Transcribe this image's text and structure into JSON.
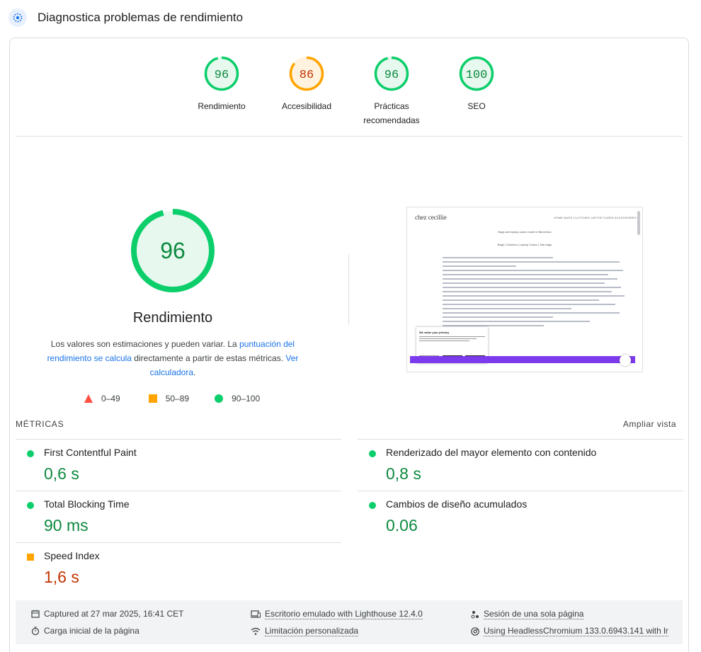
{
  "header": {
    "title": "Diagnostica problemas de rendimiento"
  },
  "scores": [
    {
      "value": "96",
      "label": "Rendimiento",
      "status": "pass"
    },
    {
      "value": "86",
      "label": "Accesibilidad",
      "status": "average"
    },
    {
      "value": "96",
      "label": "Prácticas recomendadas",
      "status": "pass"
    },
    {
      "value": "100",
      "label": "SEO",
      "status": "pass"
    }
  ],
  "main": {
    "score": "96",
    "title": "Rendimiento",
    "desc_pre": "Los valores son estimaciones y pueden variar. La ",
    "desc_link1": "puntuación del rendimiento se calcula",
    "desc_mid": " directamente a partir de estas métricas. ",
    "desc_link2": "Ver calculadora",
    "desc_end": "."
  },
  "legend": {
    "fail": "0–49",
    "average": "50–89",
    "pass": "90–100"
  },
  "screenshot": {
    "brand": "chez cecillie",
    "nav": "HOME   BAGS   CLUTCHES   LAPTOP CASES   ACCESSORIES",
    "tagline": "Bags and laptop cases made in Barcelona",
    "tabs": "Bags  |  Clutches  |  Laptop Cases  |  Tote bags",
    "cookie_title": "We value your privacy"
  },
  "metrics": {
    "heading": "MÉTRICAS",
    "expand": "Ampliar vista",
    "fcp": {
      "name": "First Contentful Paint",
      "value": "0,6 s"
    },
    "lcp": {
      "name": "Renderizado del mayor elemento con contenido",
      "value": "0,8 s"
    },
    "tbt": {
      "name": "Total Blocking Time",
      "value": "90 ms"
    },
    "cls": {
      "name": "Cambios de diseño acumulados",
      "value": "0.06"
    },
    "si": {
      "name": "Speed Index",
      "value": "1,6 s"
    }
  },
  "footer": {
    "captured": "Captured at 27 mar 2025, 16:41 CET",
    "load": "Carga inicial de la página",
    "emulated": "Escritorio emulado with Lighthouse 12.4.0",
    "throttling": "Limitación personalizada",
    "session": "Sesión de una sola página",
    "browser": "Using HeadlessChromium 133.0.6943.141 with lr"
  },
  "colors": {
    "pass": "#0cce6b",
    "average": "#ffa400",
    "fail": "#ff4e42"
  }
}
